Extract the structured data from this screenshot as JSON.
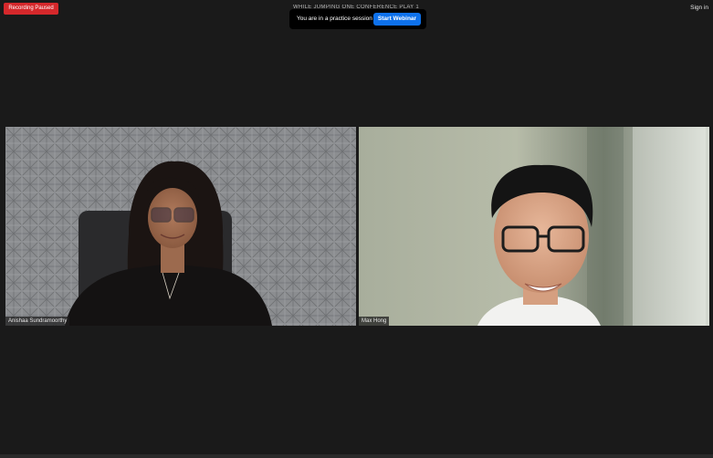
{
  "status": {
    "recording": "Recording Paused"
  },
  "meeting": {
    "title": "WHILE JUMPING ONE CONFERENCE PLAY 1 - 1 - 5-4"
  },
  "practice": {
    "message": "You are in a practice session",
    "start_button": "Start Webinar"
  },
  "header": {
    "sign_in": "Sign in"
  },
  "participants": [
    {
      "name": "Anishaa Sundramoorthy"
    },
    {
      "name": "Max Hong"
    }
  ]
}
